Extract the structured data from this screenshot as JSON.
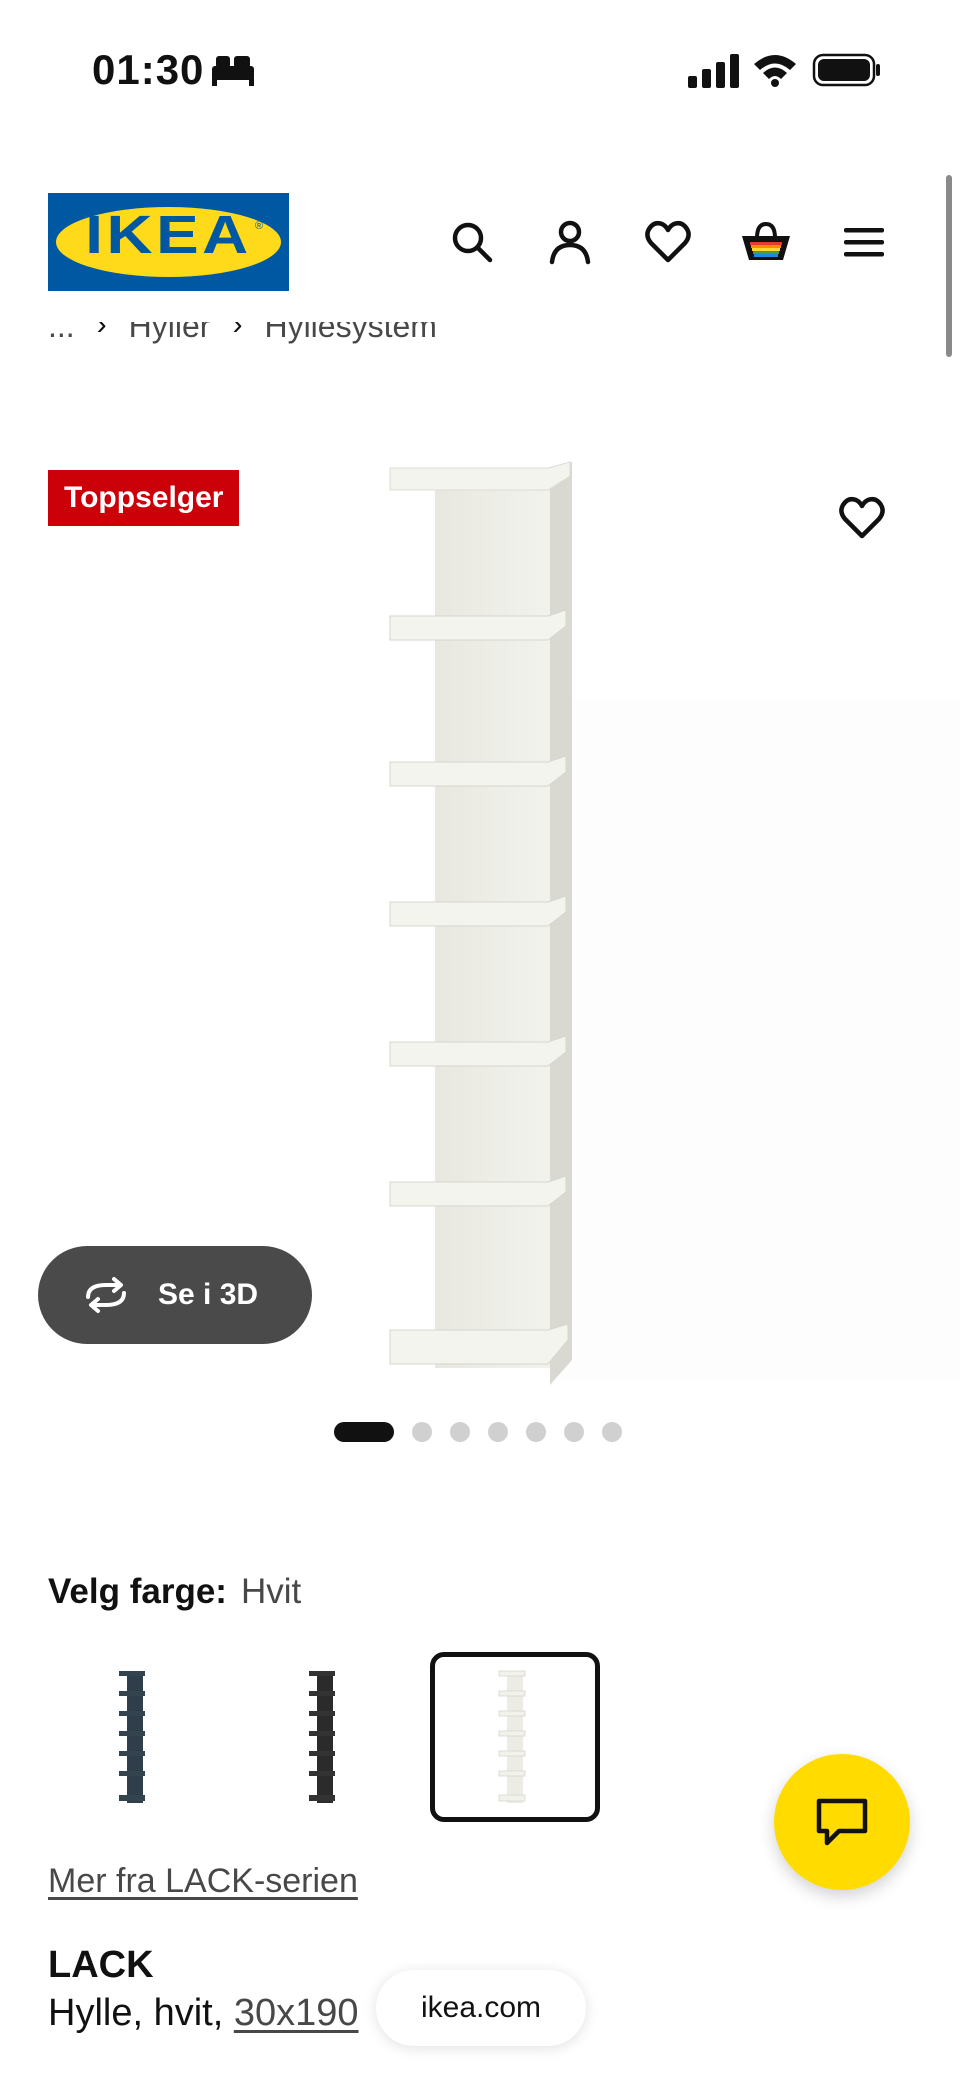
{
  "status_bar": {
    "time": "01:30"
  },
  "header": {
    "logo_text": "IKEA",
    "logo_reg": "®"
  },
  "breadcrumb": {
    "ellipsis": "...",
    "items": [
      "Hyller",
      "Hyllesystem"
    ]
  },
  "product_media": {
    "badge": "Toppselger",
    "view_3d_label": "Se i 3D",
    "image_count": 7,
    "active_image": 1
  },
  "color_selector": {
    "label": "Velg farge:",
    "value": "Hvit",
    "swatches": [
      {
        "color": "#2f3e4a",
        "selected": false
      },
      {
        "color": "#2b2b2b",
        "selected": false
      },
      {
        "color": "#f4f4ee",
        "selected": true
      }
    ]
  },
  "series_link": "Mer fra LACK-serien",
  "product": {
    "name": "LACK",
    "desc_prefix": "Hylle, hvit, ",
    "desc_size": "30x190"
  },
  "browser": {
    "url": "ikea.com"
  },
  "colors": {
    "ikea_blue": "#0058A3",
    "ikea_yellow": "#FFDA1A",
    "badge_red": "#CC0008",
    "chat_yellow": "#FFDB00"
  }
}
